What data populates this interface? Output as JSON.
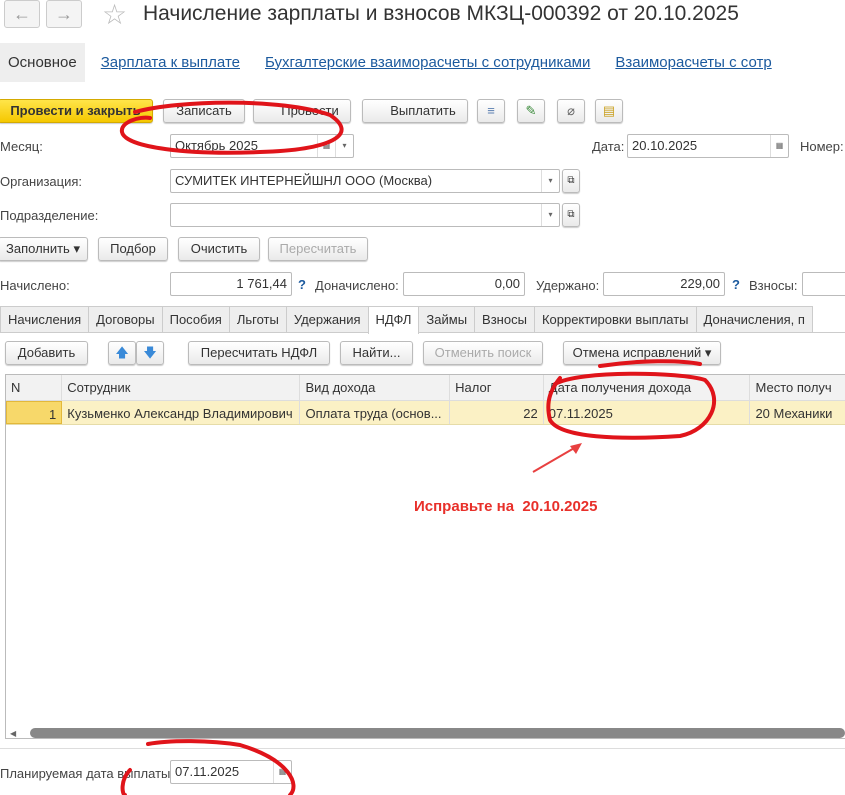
{
  "header": {
    "title": "Начисление зарплаты и взносов МКЗЦ-000392 от 20.10.2025",
    "back": "←",
    "forward": "→",
    "star": "☆"
  },
  "top_tabs": [
    "Основное",
    "Зарплата к выплате",
    "Бухгалтерские взаиморасчеты с сотрудниками",
    "Взаиморасчеты с сотр"
  ],
  "toolbar": {
    "post_close": "Провести и закрыть",
    "save": "Записать",
    "post": "Провести",
    "pay": "Выплатить"
  },
  "form": {
    "month_label": "Месяц:",
    "month": "Октябрь 2025",
    "date_label": "Дата:",
    "date": "20.10.2025",
    "number_label": "Номер:",
    "org_label": "Организация:",
    "org": "СУМИТЕК ИНТЕРНЕЙШНЛ ООО (Москва)",
    "dept_label": "Подразделение:",
    "dept": "",
    "fill": "Заполнить",
    "pick": "Подбор",
    "clear": "Очистить",
    "recalc": "Пересчитать",
    "accrued_label": "Начислено:",
    "accrued": "1 761,44",
    "extra_label": "Доначислено:",
    "extra": "0,00",
    "withheld_label": "Удержано:",
    "withheld": "229,00",
    "contrib_label": "Взносы:",
    "q": "?"
  },
  "sub_tabs": [
    "Начисления",
    "Договоры",
    "Пособия",
    "Льготы",
    "Удержания",
    "НДФЛ",
    "Займы",
    "Взносы",
    "Корректировки выплаты",
    "Доначисления, п"
  ],
  "table_toolbar": {
    "add": "Добавить",
    "recalc_ndfl": "Пересчитать НДФЛ",
    "find": "Найти...",
    "cancel_search": "Отменить поиск",
    "undo_fix": "Отмена исправлений"
  },
  "table": {
    "columns": [
      "N",
      "Сотрудник",
      "Вид дохода",
      "Налог",
      "Дата получения дохода",
      "Место получ"
    ],
    "rows": [
      [
        "1",
        "Кузьменко Александр Владимирович",
        "Оплата труда (основ...",
        "22",
        "07.11.2025",
        "20 Механики"
      ]
    ]
  },
  "annotation": "Исправьте на  20.10.2025",
  "footer": {
    "planned_label": "Планируемая дата выплаты:",
    "planned": "07.11.2025"
  }
}
